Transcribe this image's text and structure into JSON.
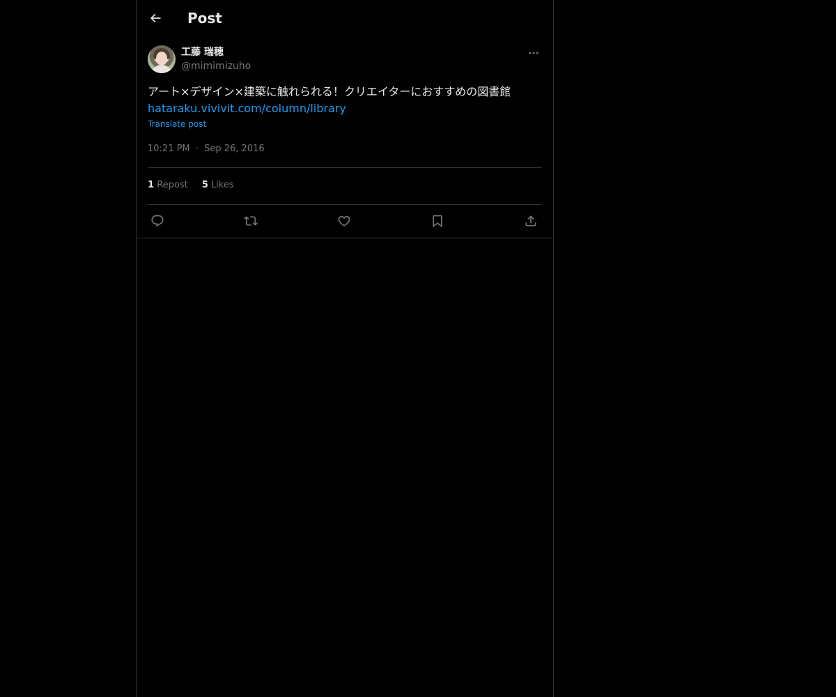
{
  "header": {
    "title": "Post"
  },
  "post": {
    "author": {
      "name": "工藤 瑞穂",
      "handle": "@mimimizuho"
    },
    "text": "アート×デザイン×建築に触れられる！クリエイターにおすすめの図書館",
    "link": "hataraku.vivivit.com/column/library",
    "translate_label": "Translate post",
    "time": "10:21 PM",
    "separator": "·",
    "date": "Sep 26, 2016",
    "stats": {
      "reposts_count": "1",
      "reposts_label": "Repost",
      "likes_count": "5",
      "likes_label": "Likes"
    }
  },
  "icons": {
    "back": "arrow-left-icon",
    "more": "more-horizontal-icon",
    "reply": "reply-icon",
    "repost": "repost-icon",
    "like": "heart-icon",
    "bookmark": "bookmark-icon",
    "share": "share-icon"
  },
  "colors": {
    "background": "#000000",
    "text": "#e7e9ea",
    "muted": "#71767b",
    "accent": "#1d9bf0",
    "border": "#2f3336"
  }
}
